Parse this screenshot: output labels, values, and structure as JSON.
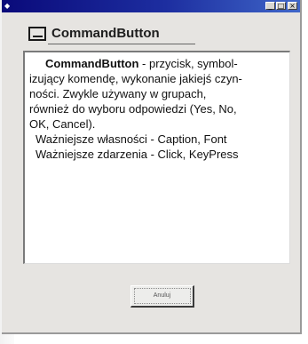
{
  "window": {
    "system_icon": "app-icon",
    "controls": [
      "_",
      "□",
      "×"
    ]
  },
  "header": {
    "icon": "commandbutton-icon",
    "title": "CommandButton"
  },
  "description": {
    "term": "CommandButton",
    "intro_lines": [
      " - przycisk, symbol-",
      "izujący komendę, wykonanie jakiejś czyn-",
      "ności. Zwykle używany w grupach,",
      "również do wyboru odpowiedzi (Yes, No,",
      "OK, Cancel)."
    ],
    "properties": "Ważniejsze własności - Caption, Font",
    "events": "Ważniejsze zdarzenia - Click, KeyPress"
  },
  "button": {
    "label": "Anuluj"
  }
}
